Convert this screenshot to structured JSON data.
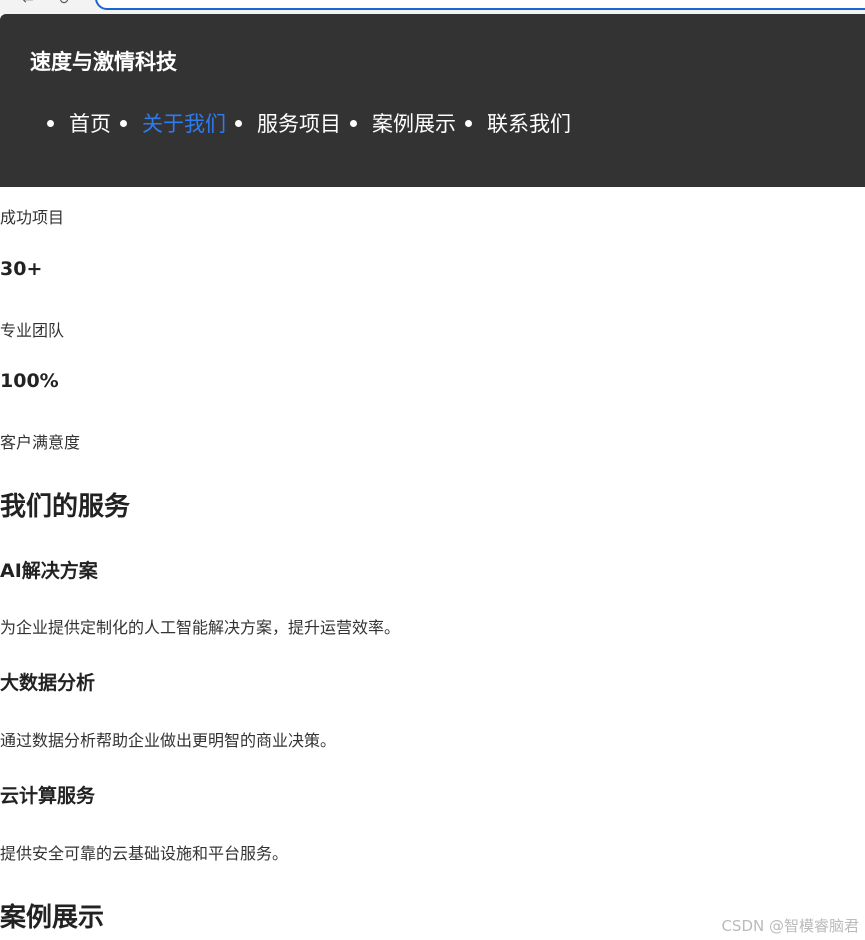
{
  "header": {
    "site_title": "速度与激情科技",
    "nav": [
      {
        "label": "首页",
        "active": false
      },
      {
        "label": "关于我们",
        "active": true
      },
      {
        "label": "服务项目",
        "active": false
      },
      {
        "label": "案例展示",
        "active": false
      },
      {
        "label": "联系我们",
        "active": false
      }
    ],
    "active_color": "#2e7bf0",
    "background_color": "#333333"
  },
  "stats": {
    "label_1": "成功项目",
    "value_1": "30+",
    "label_2": "专业团队",
    "value_2": "100%",
    "label_3": "客户满意度"
  },
  "services": {
    "title": "我们的服务",
    "items": [
      {
        "title": "AI解决方案",
        "desc": "为企业提供定制化的人工智能解决方案，提升运营效率。"
      },
      {
        "title": "大数据分析",
        "desc": "通过数据分析帮助企业做出更明智的商业决策。"
      },
      {
        "title": "云计算服务",
        "desc": "提供安全可靠的云基础设施和平台服务。"
      }
    ]
  },
  "cases": {
    "title": "案例展示"
  },
  "watermark": "CSDN @智模睿脑君"
}
